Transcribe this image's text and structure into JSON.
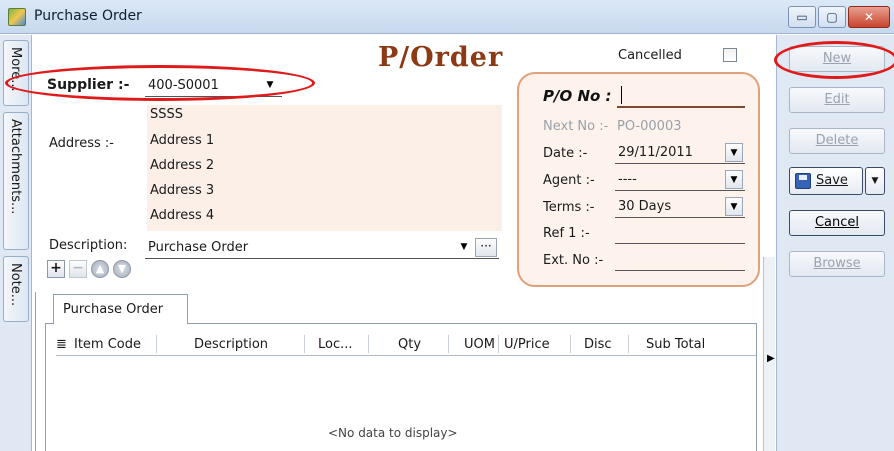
{
  "window": {
    "title": "Purchase Order",
    "controls": {
      "minimize": "▭",
      "maximize": "▢",
      "close": "✕"
    }
  },
  "side_tabs": [
    "More...",
    "Attachments...",
    "Note..."
  ],
  "form": {
    "heading": "P/Order",
    "cancelled_label": "Cancelled",
    "supplier_label": "Supplier :-",
    "supplier_value": "400-S0001",
    "supplier_name": "SSSS",
    "address_label": "Address :-",
    "address_lines": [
      "Address 1",
      "Address 2",
      "Address 3",
      "Address 4"
    ],
    "description_label": "Description:",
    "description_value": "Purchase Order",
    "ellipsis": "···"
  },
  "po_panel": {
    "po_no_label": "P/O No :",
    "po_no_value": "",
    "next_no_label": "Next No :-",
    "next_no_value": "PO-00003",
    "date_label": "Date :-",
    "date_value": "29/11/2011",
    "agent_label": "Agent :-",
    "agent_value": "----",
    "terms_label": "Terms :-",
    "terms_value": "30 Days",
    "ref1_label": "Ref 1 :-",
    "ref1_value": "",
    "extno_label": "Ext. No :-",
    "extno_value": ""
  },
  "grid_toolbar": {
    "add": "+",
    "remove": "−",
    "up": "▲",
    "down": "▼"
  },
  "tab": {
    "label": "Purchase Order"
  },
  "grid": {
    "menu_glyph": "≣",
    "columns": [
      "Item Code",
      "Description",
      "Loc...",
      "Qty",
      "UOM",
      "U/Price",
      "Disc",
      "Sub Total"
    ],
    "empty_text": "<No data to display>"
  },
  "actions": {
    "new": "New",
    "edit": "Edit",
    "delete": "Delete",
    "save": "Save",
    "cancel": "Cancel",
    "browse": "Browse"
  },
  "colors": {
    "accent_heading": "#8b3a15",
    "highlight_circle": "#e01a1a",
    "panel_border": "#e0a07a",
    "field_background": "#fbefe7"
  }
}
